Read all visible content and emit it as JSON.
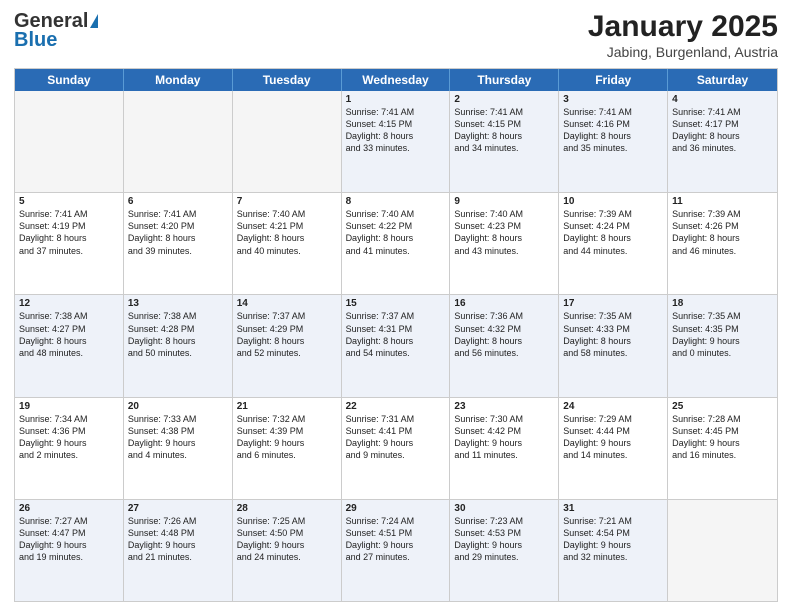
{
  "header": {
    "logo_line1": "General",
    "logo_line2": "Blue",
    "title": "January 2025",
    "subtitle": "Jabing, Burgenland, Austria"
  },
  "weekdays": [
    "Sunday",
    "Monday",
    "Tuesday",
    "Wednesday",
    "Thursday",
    "Friday",
    "Saturday"
  ],
  "rows": [
    [
      {
        "day": "",
        "text": ""
      },
      {
        "day": "",
        "text": ""
      },
      {
        "day": "",
        "text": ""
      },
      {
        "day": "1",
        "text": "Sunrise: 7:41 AM\nSunset: 4:15 PM\nDaylight: 8 hours\nand 33 minutes."
      },
      {
        "day": "2",
        "text": "Sunrise: 7:41 AM\nSunset: 4:15 PM\nDaylight: 8 hours\nand 34 minutes."
      },
      {
        "day": "3",
        "text": "Sunrise: 7:41 AM\nSunset: 4:16 PM\nDaylight: 8 hours\nand 35 minutes."
      },
      {
        "day": "4",
        "text": "Sunrise: 7:41 AM\nSunset: 4:17 PM\nDaylight: 8 hours\nand 36 minutes."
      }
    ],
    [
      {
        "day": "5",
        "text": "Sunrise: 7:41 AM\nSunset: 4:19 PM\nDaylight: 8 hours\nand 37 minutes."
      },
      {
        "day": "6",
        "text": "Sunrise: 7:41 AM\nSunset: 4:20 PM\nDaylight: 8 hours\nand 39 minutes."
      },
      {
        "day": "7",
        "text": "Sunrise: 7:40 AM\nSunset: 4:21 PM\nDaylight: 8 hours\nand 40 minutes."
      },
      {
        "day": "8",
        "text": "Sunrise: 7:40 AM\nSunset: 4:22 PM\nDaylight: 8 hours\nand 41 minutes."
      },
      {
        "day": "9",
        "text": "Sunrise: 7:40 AM\nSunset: 4:23 PM\nDaylight: 8 hours\nand 43 minutes."
      },
      {
        "day": "10",
        "text": "Sunrise: 7:39 AM\nSunset: 4:24 PM\nDaylight: 8 hours\nand 44 minutes."
      },
      {
        "day": "11",
        "text": "Sunrise: 7:39 AM\nSunset: 4:26 PM\nDaylight: 8 hours\nand 46 minutes."
      }
    ],
    [
      {
        "day": "12",
        "text": "Sunrise: 7:38 AM\nSunset: 4:27 PM\nDaylight: 8 hours\nand 48 minutes."
      },
      {
        "day": "13",
        "text": "Sunrise: 7:38 AM\nSunset: 4:28 PM\nDaylight: 8 hours\nand 50 minutes."
      },
      {
        "day": "14",
        "text": "Sunrise: 7:37 AM\nSunset: 4:29 PM\nDaylight: 8 hours\nand 52 minutes."
      },
      {
        "day": "15",
        "text": "Sunrise: 7:37 AM\nSunset: 4:31 PM\nDaylight: 8 hours\nand 54 minutes."
      },
      {
        "day": "16",
        "text": "Sunrise: 7:36 AM\nSunset: 4:32 PM\nDaylight: 8 hours\nand 56 minutes."
      },
      {
        "day": "17",
        "text": "Sunrise: 7:35 AM\nSunset: 4:33 PM\nDaylight: 8 hours\nand 58 minutes."
      },
      {
        "day": "18",
        "text": "Sunrise: 7:35 AM\nSunset: 4:35 PM\nDaylight: 9 hours\nand 0 minutes."
      }
    ],
    [
      {
        "day": "19",
        "text": "Sunrise: 7:34 AM\nSunset: 4:36 PM\nDaylight: 9 hours\nand 2 minutes."
      },
      {
        "day": "20",
        "text": "Sunrise: 7:33 AM\nSunset: 4:38 PM\nDaylight: 9 hours\nand 4 minutes."
      },
      {
        "day": "21",
        "text": "Sunrise: 7:32 AM\nSunset: 4:39 PM\nDaylight: 9 hours\nand 6 minutes."
      },
      {
        "day": "22",
        "text": "Sunrise: 7:31 AM\nSunset: 4:41 PM\nDaylight: 9 hours\nand 9 minutes."
      },
      {
        "day": "23",
        "text": "Sunrise: 7:30 AM\nSunset: 4:42 PM\nDaylight: 9 hours\nand 11 minutes."
      },
      {
        "day": "24",
        "text": "Sunrise: 7:29 AM\nSunset: 4:44 PM\nDaylight: 9 hours\nand 14 minutes."
      },
      {
        "day": "25",
        "text": "Sunrise: 7:28 AM\nSunset: 4:45 PM\nDaylight: 9 hours\nand 16 minutes."
      }
    ],
    [
      {
        "day": "26",
        "text": "Sunrise: 7:27 AM\nSunset: 4:47 PM\nDaylight: 9 hours\nand 19 minutes."
      },
      {
        "day": "27",
        "text": "Sunrise: 7:26 AM\nSunset: 4:48 PM\nDaylight: 9 hours\nand 21 minutes."
      },
      {
        "day": "28",
        "text": "Sunrise: 7:25 AM\nSunset: 4:50 PM\nDaylight: 9 hours\nand 24 minutes."
      },
      {
        "day": "29",
        "text": "Sunrise: 7:24 AM\nSunset: 4:51 PM\nDaylight: 9 hours\nand 27 minutes."
      },
      {
        "day": "30",
        "text": "Sunrise: 7:23 AM\nSunset: 4:53 PM\nDaylight: 9 hours\nand 29 minutes."
      },
      {
        "day": "31",
        "text": "Sunrise: 7:21 AM\nSunset: 4:54 PM\nDaylight: 9 hours\nand 32 minutes."
      },
      {
        "day": "",
        "text": ""
      }
    ]
  ],
  "alt_rows": [
    0,
    2,
    4
  ]
}
